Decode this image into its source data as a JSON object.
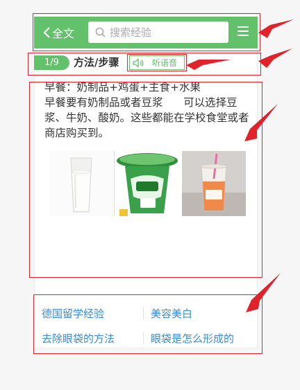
{
  "header": {
    "back_label": "全文",
    "search_placeholder": "搜索经验",
    "colors": {
      "brand_green": "#62c16a"
    }
  },
  "step": {
    "badge": "1/9",
    "title": "方法/步骤",
    "listen_label": "听语音"
  },
  "content": {
    "lines": [
      "早餐：奶制品+鸡蛋+主食+水果",
      "早餐要有奶制品或者豆浆      可以选择豆浆、牛奶、酸奶。这些都能在学校食堂或者商店购买到。"
    ]
  },
  "images": [
    {
      "name": "glass-of-milk-image"
    },
    {
      "name": "yogurt-cup-image"
    },
    {
      "name": "bubble-tea-image"
    }
  ],
  "related": [
    {
      "label": "德国留学经验"
    },
    {
      "label": "美容美白"
    },
    {
      "label": "去除眼袋的方法"
    },
    {
      "label": "眼袋是怎么形成的"
    }
  ],
  "annotation": {
    "color": "#e0222a"
  }
}
